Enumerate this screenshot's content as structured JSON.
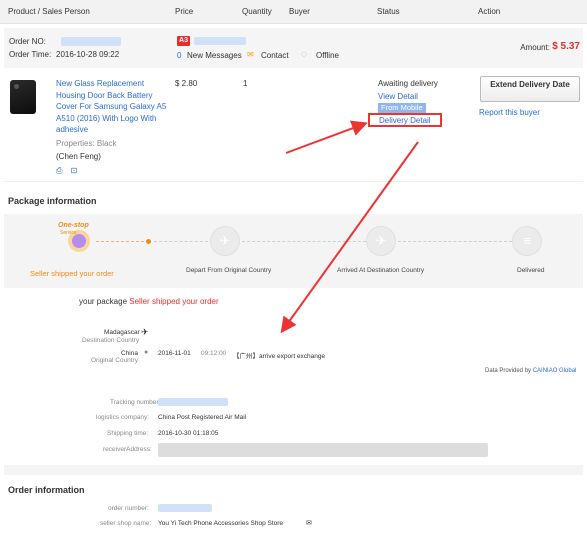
{
  "header": {
    "col_product": "Product / Sales Person",
    "col_price": "Price",
    "col_quantity": "Quantity",
    "col_buyer": "Buyer",
    "col_status": "Status",
    "col_action": "Action"
  },
  "order": {
    "order_no_label": "Order NO:",
    "order_time_label": "Order Time:",
    "order_time": "2016-10-28 09:22",
    "badge": "A3",
    "new_messages": "New Messages",
    "new_messages_count": "0",
    "contact": "Contact",
    "offline": "Offline",
    "amount_label": "Amount:",
    "amount": "$ 5.37"
  },
  "product": {
    "title": "New Glass Replacement Housing Door Back Battery Cover For Samsung Galaxy A5 A510 (2016) With Logo With adhesive",
    "properties": "Properties: Black",
    "seller": "(Chen Feng)",
    "price": "$ 2.80",
    "quantity": "1",
    "status": "Awaiting delivery",
    "view_detail": "View Detail",
    "from_mobile": "From Mobile",
    "delivery_detail": "Delivery Detail",
    "extend_button": "Extend Delivery Date",
    "report_buyer": "Report this buyer"
  },
  "package": {
    "title": "Package information",
    "step_label_top": "One-stop",
    "step_label_sub": "Service",
    "steps": [
      "Seller shipped your order",
      "Depart From Original Country",
      "Arrived At Destination Country",
      "Delivered"
    ],
    "status_prefix": "your package",
    "status_value": "Seller shipped your order",
    "dest_country": "Madagascar",
    "dest_label": "Destination Country",
    "origin_country": "China",
    "origin_label": "Original Country",
    "event_date": "2016-11-01",
    "event_time": "09:12:00",
    "event_text": "【广州】arrive export exchange",
    "provider": "Data Provided by",
    "provider_name": "CAINIAO Global",
    "tracking_label": "Tracking number:",
    "logistics_label": "logistics company:",
    "logistics_value": "China Post Registered Air Mail",
    "shipping_label": "Shipping time:",
    "shipping_value": "2016-10-30 01:18:05",
    "receiver_label": "receiverAddress:"
  },
  "order_info": {
    "title": "Order information",
    "order_number_label": "order number:",
    "shop_label": "seller shop name:",
    "shop_value": "You Yi Tech Phone Accessories Shop Store"
  },
  "colors": {
    "accent_red": "#e62e2e",
    "link_blue": "#2a6cd3",
    "progress_orange": "#f08a1c"
  }
}
